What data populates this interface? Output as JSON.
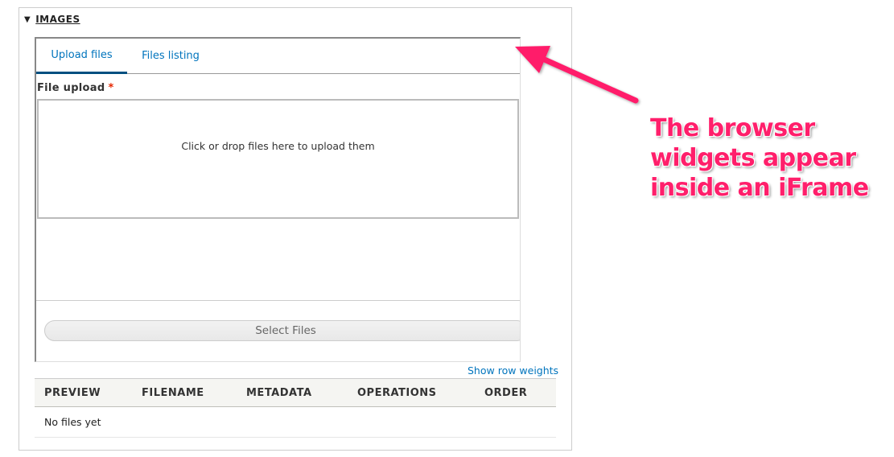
{
  "fieldset": {
    "legend": "IMAGES",
    "toggle_glyph": "▼"
  },
  "tabs": [
    {
      "label": "Upload files",
      "active": true
    },
    {
      "label": "Files listing",
      "active": false
    }
  ],
  "upload": {
    "label": "File upload",
    "required_marker": "*",
    "dropzone_text": "Click or drop files here to upload them",
    "select_button": "Select Files"
  },
  "table": {
    "show_row_weights": "Show row weights",
    "headers": [
      "PREVIEW",
      "FILENAME",
      "METADATA",
      "OPERATIONS",
      "ORDER"
    ],
    "empty_text": "No files yet"
  },
  "annotation": {
    "text": "The browser\nwidgets appear\ninside an iFrame",
    "color": "#ff1f6b"
  },
  "colors": {
    "link": "#0074bd",
    "active_tab_underline": "#004f80",
    "required": "#e62600"
  }
}
